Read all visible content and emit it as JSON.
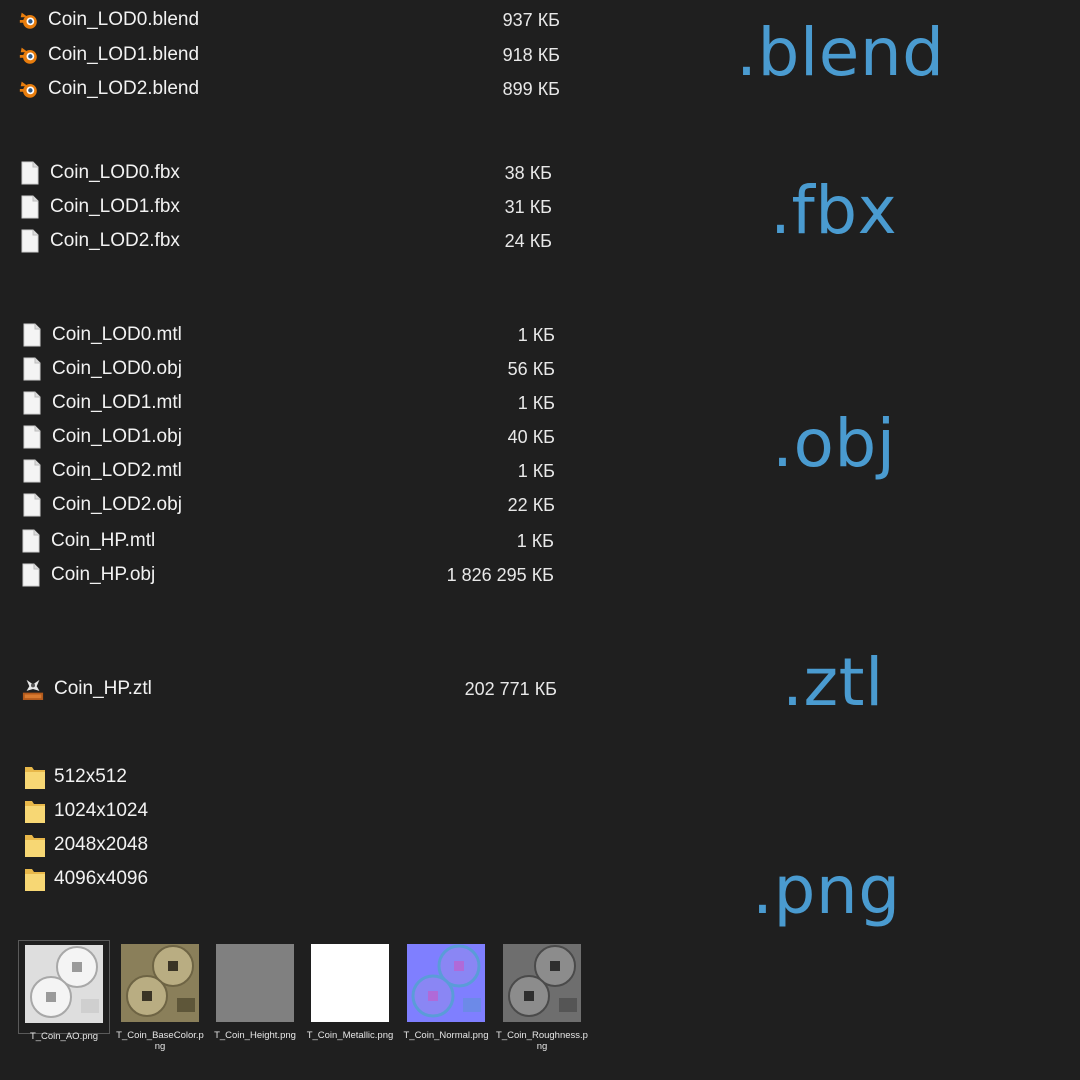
{
  "groups": {
    "blend": {
      "ext": ".blend",
      "files": [
        {
          "name": "Coin_LOD0.blend",
          "size": "937 КБ",
          "icon": "blender-icon"
        },
        {
          "name": "Coin_LOD1.blend",
          "size": "918 КБ",
          "icon": "blender-icon"
        },
        {
          "name": "Coin_LOD2.blend",
          "size": "899 КБ",
          "icon": "blender-icon"
        }
      ]
    },
    "fbx": {
      "ext": ".fbx",
      "files": [
        {
          "name": "Coin_LOD0.fbx",
          "size": "38 КБ",
          "icon": "file-icon"
        },
        {
          "name": "Coin_LOD1.fbx",
          "size": "31 КБ",
          "icon": "file-icon"
        },
        {
          "name": "Coin_LOD2.fbx",
          "size": "24 КБ",
          "icon": "file-icon"
        }
      ]
    },
    "obj": {
      "ext": ".obj",
      "files": [
        {
          "name": "Coin_LOD0.mtl",
          "size": "1 КБ",
          "icon": "file-icon"
        },
        {
          "name": "Coin_LOD0.obj",
          "size": "56 КБ",
          "icon": "file-icon"
        },
        {
          "name": "Coin_LOD1.mtl",
          "size": "1 КБ",
          "icon": "file-icon"
        },
        {
          "name": "Coin_LOD1.obj",
          "size": "40 КБ",
          "icon": "file-icon"
        },
        {
          "name": "Coin_LOD2.mtl",
          "size": "1 КБ",
          "icon": "file-icon"
        },
        {
          "name": "Coin_LOD2.obj",
          "size": "22 КБ",
          "icon": "file-icon"
        },
        {
          "name": "Coin_HP.mtl",
          "size": "1 КБ",
          "icon": "file-icon"
        },
        {
          "name": "Coin_HP.obj",
          "size": "1 826 295 КБ",
          "icon": "file-icon"
        }
      ]
    },
    "ztl": {
      "ext": ".ztl",
      "files": [
        {
          "name": "Coin_HP.ztl",
          "size": "202 771 КБ",
          "icon": "zbrush-icon"
        }
      ]
    },
    "png": {
      "ext": ".png",
      "folders": [
        {
          "name": "512x512",
          "icon": "folder-icon"
        },
        {
          "name": "1024x1024",
          "icon": "folder-icon"
        },
        {
          "name": "2048x2048",
          "icon": "folder-icon"
        },
        {
          "name": "4096x4096",
          "icon": "folder-icon"
        }
      ],
      "thumbnails": [
        {
          "caption": "T_Coin_AO.png",
          "selected": true
        },
        {
          "caption": "T_Coin_BaseColor.png",
          "selected": false
        },
        {
          "caption": "T_Coin_Height.png",
          "selected": false
        },
        {
          "caption": "T_Coin_Metallic.png",
          "selected": false
        },
        {
          "caption": "T_Coin_Normal.png",
          "selected": false
        },
        {
          "caption": "T_Coin_Roughness.png",
          "selected": false
        }
      ]
    }
  },
  "colors": {
    "background": "#1f1f1f",
    "accent": "#4a9bd0",
    "text": "#f2f2f2",
    "folder": "#f5d36b",
    "blender_orange": "#e87d0d"
  }
}
